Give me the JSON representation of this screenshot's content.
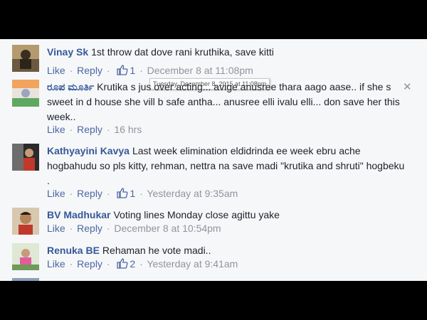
{
  "comments": [
    {
      "author": "Vinay Sk",
      "text": "1st throw dat dove rani kruthika, save kitti",
      "like": "Like",
      "reply": "Reply",
      "likes": "1",
      "time": "December 8 at 11:08pm"
    },
    {
      "author": "ರೂಪ ಮೂರ್ತಿ",
      "text": "Krutika s jus over acting... avige anusree thara aago aase.. if she s sweet in d house she vill b safe antha... anusree elli ivalu elli... don save her this week..",
      "like": "Like",
      "reply": "Reply",
      "time": "16 hrs"
    },
    {
      "author": "Kathyayini Kavya",
      "text": "Last week elimination eldidrinda ee week ebru ache hogbahudu so pls kitty, rehman, nettra na save madi \"krutika and shruti\" hogbeku .",
      "like": "Like",
      "reply": "Reply",
      "likes": "1",
      "time": "Yesterday at 9:35am"
    },
    {
      "author": "BV Madhukar",
      "text": "Voting lines Monday close agittu yake",
      "like": "Like",
      "reply": "Reply",
      "time": "December 8 at 10:54pm"
    },
    {
      "author": "Renuka BE",
      "text": "Rehaman he vote madi..",
      "like": "Like",
      "reply": "Reply",
      "likes": "2",
      "time": "Yesterday at 9:41am"
    }
  ],
  "tooltip": "Tuesday, December 8, 2015 at 11:08pm",
  "sep": "·",
  "icons": {
    "like": "thumbs-up-icon",
    "close": "close-icon"
  },
  "colors": {
    "author": "#365899",
    "link": "#4b67a1",
    "meta": "#90949c",
    "background": "#f6f7f9"
  }
}
